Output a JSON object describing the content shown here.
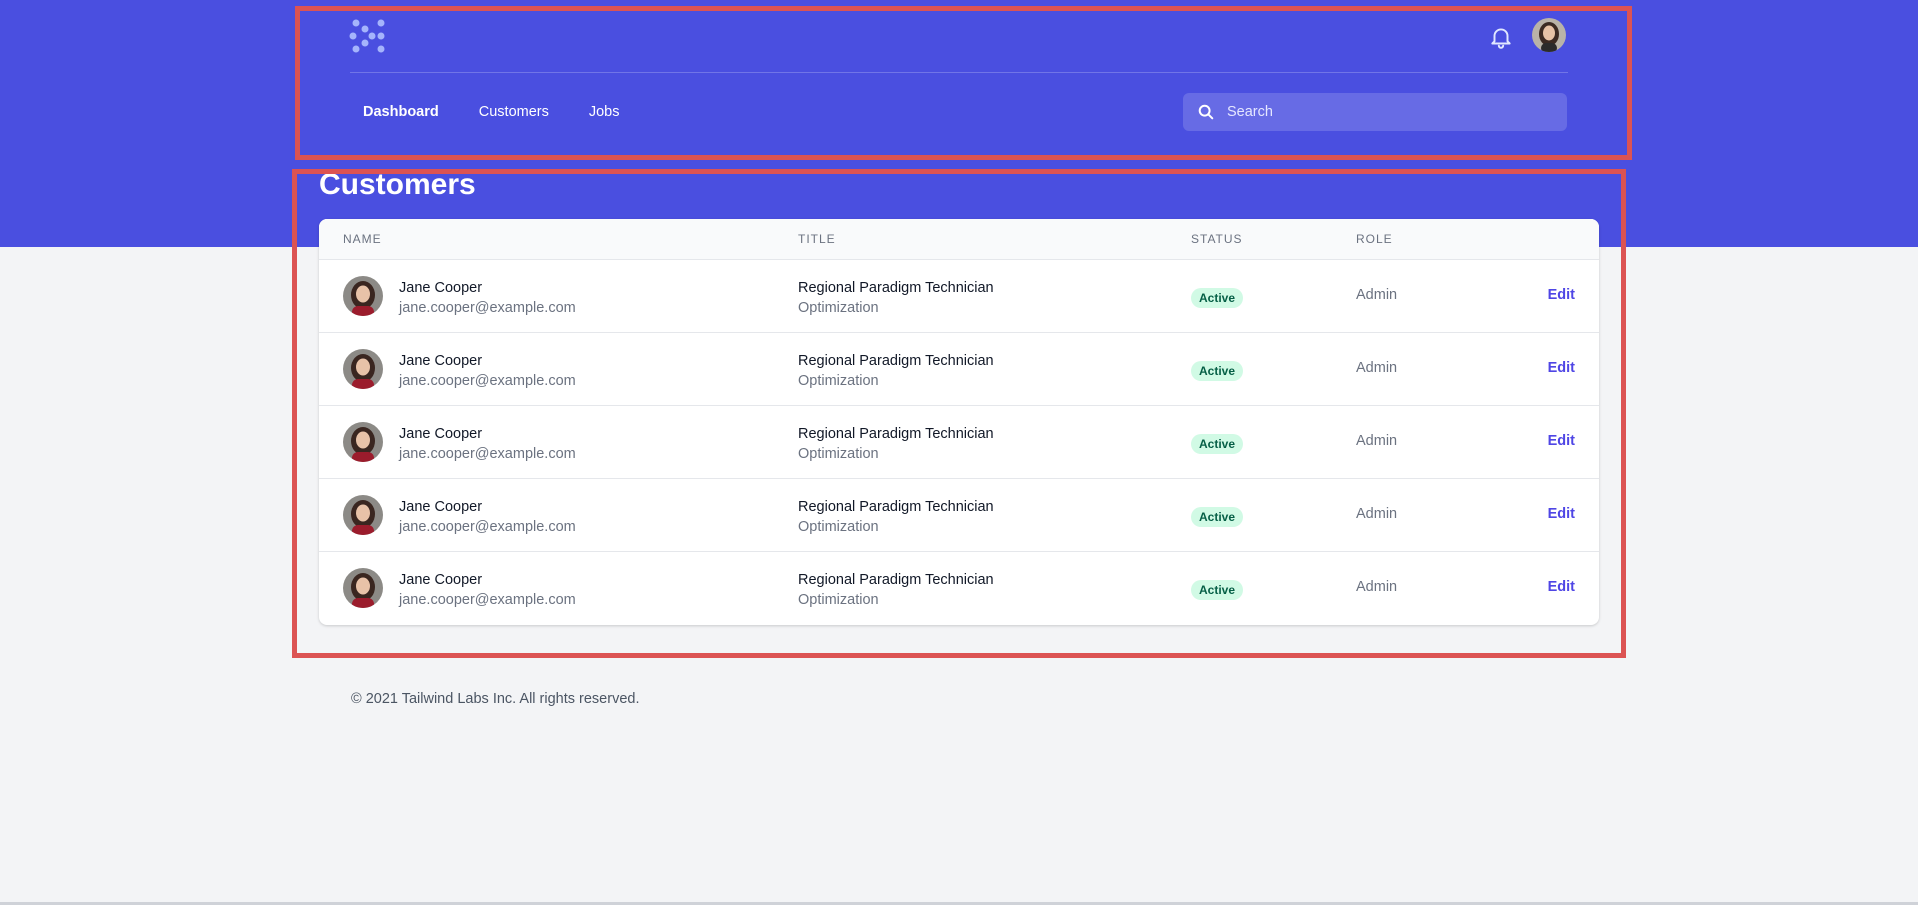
{
  "header": {
    "nav": [
      {
        "label": "Dashboard"
      },
      {
        "label": "Customers"
      },
      {
        "label": "Jobs"
      }
    ],
    "search": {
      "placeholder": "Search"
    }
  },
  "page": {
    "title": "Customers"
  },
  "table": {
    "columns": {
      "name": "Name",
      "title": "Title",
      "status": "Status",
      "role": "Role"
    },
    "rows": [
      {
        "name": "Jane Cooper",
        "email": "jane.cooper@example.com",
        "title": "Regional Paradigm Technician",
        "department": "Optimization",
        "status": "Active",
        "role": "Admin",
        "action": "Edit"
      },
      {
        "name": "Jane Cooper",
        "email": "jane.cooper@example.com",
        "title": "Regional Paradigm Technician",
        "department": "Optimization",
        "status": "Active",
        "role": "Admin",
        "action": "Edit"
      },
      {
        "name": "Jane Cooper",
        "email": "jane.cooper@example.com",
        "title": "Regional Paradigm Technician",
        "department": "Optimization",
        "status": "Active",
        "role": "Admin",
        "action": "Edit"
      },
      {
        "name": "Jane Cooper",
        "email": "jane.cooper@example.com",
        "title": "Regional Paradigm Technician",
        "department": "Optimization",
        "status": "Active",
        "role": "Admin",
        "action": "Edit"
      },
      {
        "name": "Jane Cooper",
        "email": "jane.cooper@example.com",
        "title": "Regional Paradigm Technician",
        "department": "Optimization",
        "status": "Active",
        "role": "Admin",
        "action": "Edit"
      }
    ]
  },
  "footer": {
    "text": "© 2021 Tailwind Labs Inc. All rights reserved."
  },
  "colors": {
    "brand": "#4a4fe0",
    "highlight": "#dc5353",
    "status_active_bg": "#d1fae5",
    "status_active_text": "#065f46",
    "link": "#4f46e5"
  },
  "icons": {
    "logo": "logo-icon",
    "notifications": "bell-icon",
    "search": "search-icon"
  }
}
